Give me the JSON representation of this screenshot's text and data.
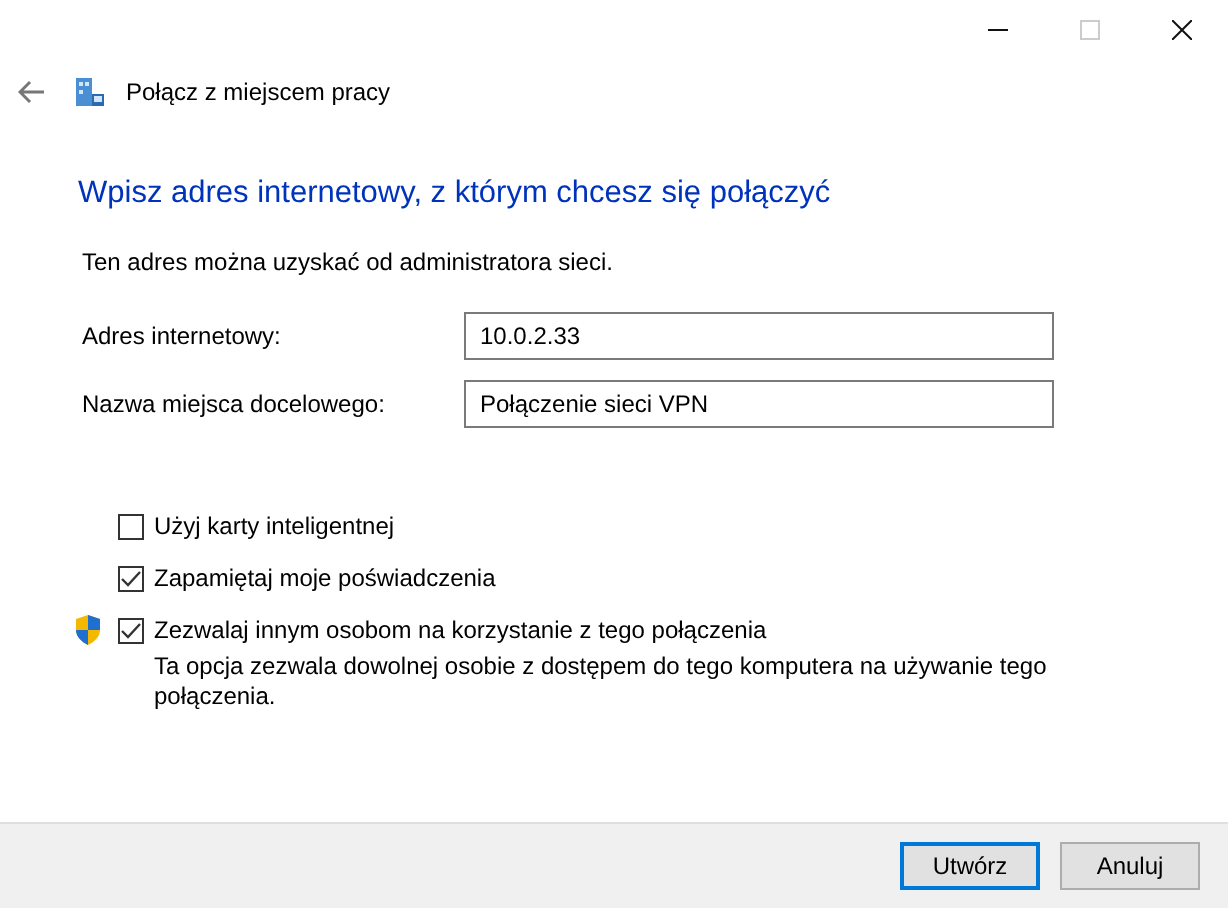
{
  "window_controls": [
    {
      "kind": "minimize",
      "disabled": false
    },
    {
      "kind": "maximize",
      "disabled": true
    },
    {
      "kind": "close",
      "disabled": false
    }
  ],
  "header": {
    "title": "Połącz z miejscem pracy"
  },
  "heading": "Wpisz adres internetowy, z którym chcesz się połączyć",
  "info": "Ten adres można uzyskać od administratora sieci.",
  "fields": [
    {
      "label": "Adres internetowy:",
      "value": "10.0.2.33"
    },
    {
      "label": "Nazwa miejsca docelowego:",
      "value": "Połączenie sieci VPN"
    }
  ],
  "options": [
    {
      "label": "Użyj karty inteligentnej",
      "checked": false,
      "shield": false
    },
    {
      "label": "Zapamiętaj moje poświadczenia",
      "checked": true,
      "shield": false
    },
    {
      "label": "Zezwalaj innym osobom na korzystanie z tego połączenia",
      "checked": true,
      "shield": true,
      "description": "Ta opcja zezwala dowolnej osobie z dostępem do tego komputera na używanie tego połączenia."
    }
  ],
  "buttons": [
    {
      "label": "Utwórz",
      "default": true
    },
    {
      "label": "Anuluj",
      "default": false
    }
  ]
}
